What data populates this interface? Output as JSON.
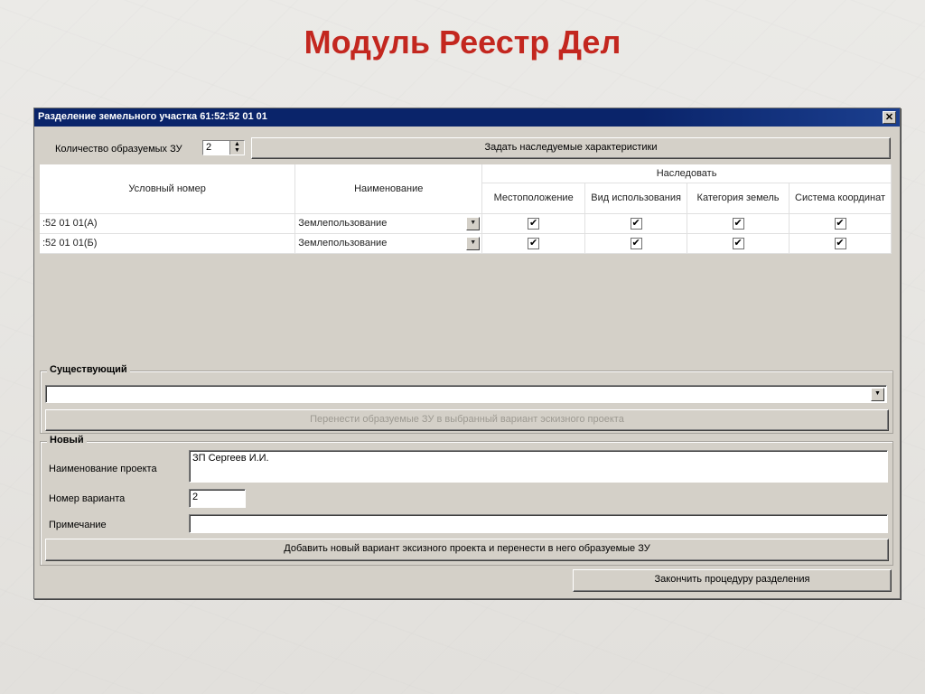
{
  "slide": {
    "title": "Модуль Реестр Дел"
  },
  "window": {
    "title": "Разделение земельного участка 61:52:52 01 01",
    "close_glyph": "✕"
  },
  "top": {
    "count_label": "Количество образуемых ЗУ",
    "count_value": "2",
    "inherit_button": "Задать наследуемые характеристики"
  },
  "table": {
    "headers": {
      "cond_number": "Условный номер",
      "name": "Наименование",
      "inherit": "Наследовать",
      "location": "Местоположение",
      "usage": "Вид использования",
      "land_category": "Категория земель",
      "coord_system": "Система координат"
    },
    "rows": [
      {
        "cond_number": ":52 01 01(А)",
        "name": "Землепользование",
        "location": true,
        "usage": true,
        "land_category": true,
        "coord_system": true
      },
      {
        "cond_number": ":52 01 01(Б)",
        "name": "Землепользование",
        "location": true,
        "usage": true,
        "land_category": true,
        "coord_system": true
      }
    ],
    "check_glyph": "✔"
  },
  "existing": {
    "title": "Существующий",
    "selected_value": "",
    "transfer_button": "Перенести образуемые ЗУ в выбранный вариант эскизного проекта"
  },
  "new": {
    "title": "Новый",
    "project_name_label": "Наименование проекта",
    "project_name_value": "ЗП Сергеев И.И.",
    "variant_label": "Номер варианта",
    "variant_value": "2",
    "note_label": "Примечание",
    "note_value": "",
    "add_button": "Добавить новый вариант эксизного проекта и перенести в него образуемые ЗУ"
  },
  "finish_button": "Закончить процедуру разделения",
  "colors": {
    "title_red": "#c3271f",
    "titlebar_blue": "#0a246a",
    "window_bg": "#d4d0c8"
  }
}
